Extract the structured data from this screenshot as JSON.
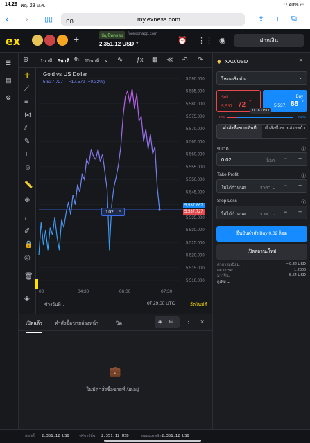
{
  "status": {
    "time": "14:29",
    "date": "พฤ. 29 ม.ค.",
    "battery": "40%"
  },
  "browser": {
    "aa": "กก",
    "url": "my.exness.com"
  },
  "header": {
    "logo": "ex",
    "account_type": "บัญชีทดลอง",
    "server": "forexonapp.com",
    "balance": "2,351.12 USD",
    "deposit": "ฝากเงิน"
  },
  "chart": {
    "timeframes": [
      "1นาที",
      "5นาที",
      "4h",
      "15นาที"
    ],
    "active_tf": "5นาที",
    "title": "Gold vs US Dollar",
    "quote": "5,537.727",
    "change": "−17.579 (−0.32%)",
    "time_label": "07:29:00 UTC",
    "range_label": "ช่วงวันที่",
    "auto_label": "อัตโนมัติ",
    "order_tag": "0.02",
    "price_ask_label": "5,537.887",
    "price_bid_label": "5,537.727",
    "y_ticks": [
      "5,590.000",
      "5,585.000",
      "5,580.000",
      "5,575.000",
      "5,570.000",
      "5,565.000",
      "5,560.000",
      "5,555.000",
      "5,550.000",
      "5,545.000",
      "5,540.000",
      "5,535.000",
      "5,530.000",
      "5,525.000",
      "5,520.000",
      "5,515.000",
      "5,510.000"
    ],
    "x_ticks": [
      "00",
      "04:30",
      "06:00",
      "07:30"
    ]
  },
  "chart_data": {
    "type": "line",
    "title": "Gold vs US Dollar",
    "ylim": [
      5507,
      5592
    ],
    "series": [
      {
        "name": "",
        "values": [
          5520,
          5533,
          5524,
          5530,
          5522,
          5531,
          5528,
          5535,
          5527,
          5522,
          5534,
          5531,
          5537,
          5541,
          5536,
          5544,
          5540,
          5548,
          5545,
          5552,
          5550,
          5558,
          5556,
          5562,
          5559,
          5558,
          5562,
          5557,
          5560,
          5553,
          5546,
          5522,
          5540,
          5547,
          5551,
          5556,
          5563,
          5575,
          5583,
          5585,
          5580,
          5586,
          5578,
          5584,
          5573,
          5575,
          5565,
          5570,
          5562,
          5568,
          5560,
          5563,
          5547,
          5538
        ]
      }
    ]
  },
  "bottom": {
    "tabs": [
      "เปิดแล้ว",
      "คำสั่งซื้อขายล่วงหน้า",
      "ปิด"
    ],
    "empty": "ไม่มีคำสั่งซื้อขายที่เปิดอยู่"
  },
  "order_panel": {
    "symbol": "XAU/USD",
    "mode": "โหมดเริ่มต้น",
    "sell_label": "Sell",
    "sell_price_small": "5,537.",
    "sell_price_big": "72",
    "sell_price_sup": "7",
    "buy_label": "Buy",
    "buy_price_small": "5,537.",
    "buy_price_big": "88",
    "buy_price_sup": "7",
    "spread": "0.16 USD",
    "sell_pct": "16%",
    "buy_pct": "84%",
    "sell_pct_value": 16,
    "tab_market": "คำสั่งซื้อขายทันที",
    "tab_pending": "คำสั่งซื้อขายล่วงหน้า",
    "volume_label": "ขนาด",
    "volume": "0.02",
    "volume_unit": "ล็อต",
    "tp_label": "Take Profit",
    "sl_label": "Stop Loss",
    "not_set": "ไม่ได้กำหนด",
    "price_unit": "ราคา",
    "confirm": "ยืนยันคำสั่ง Buy 0.02 ล็อต",
    "cancel": "เปิดสถานะใหม่",
    "fee_label": "ค่าธรรมเนียม:",
    "fee_value": "≈ 0.32 USD",
    "leverage_label": "เลเวอเรจ:",
    "leverage_value": "1:2000",
    "margin_label": "มาร์จิ้น:",
    "margin_value": "5.54 USD",
    "more": "ดูเพิ่ม"
  },
  "footer": {
    "equity_label": "อิควิตี้:",
    "equity": "2,351.12 USD",
    "free_margin_label": "ฟรีมาร์จิ้น:",
    "free_margin": "2,351.12 USD",
    "balance_label": "ยอดคงเหลือ:",
    "balance": "2,351.12 USD"
  },
  "colors": {
    "accent": "#ffde02",
    "buy": "#158bff",
    "sell": "#e5484d",
    "line": "#6c7cf0"
  }
}
